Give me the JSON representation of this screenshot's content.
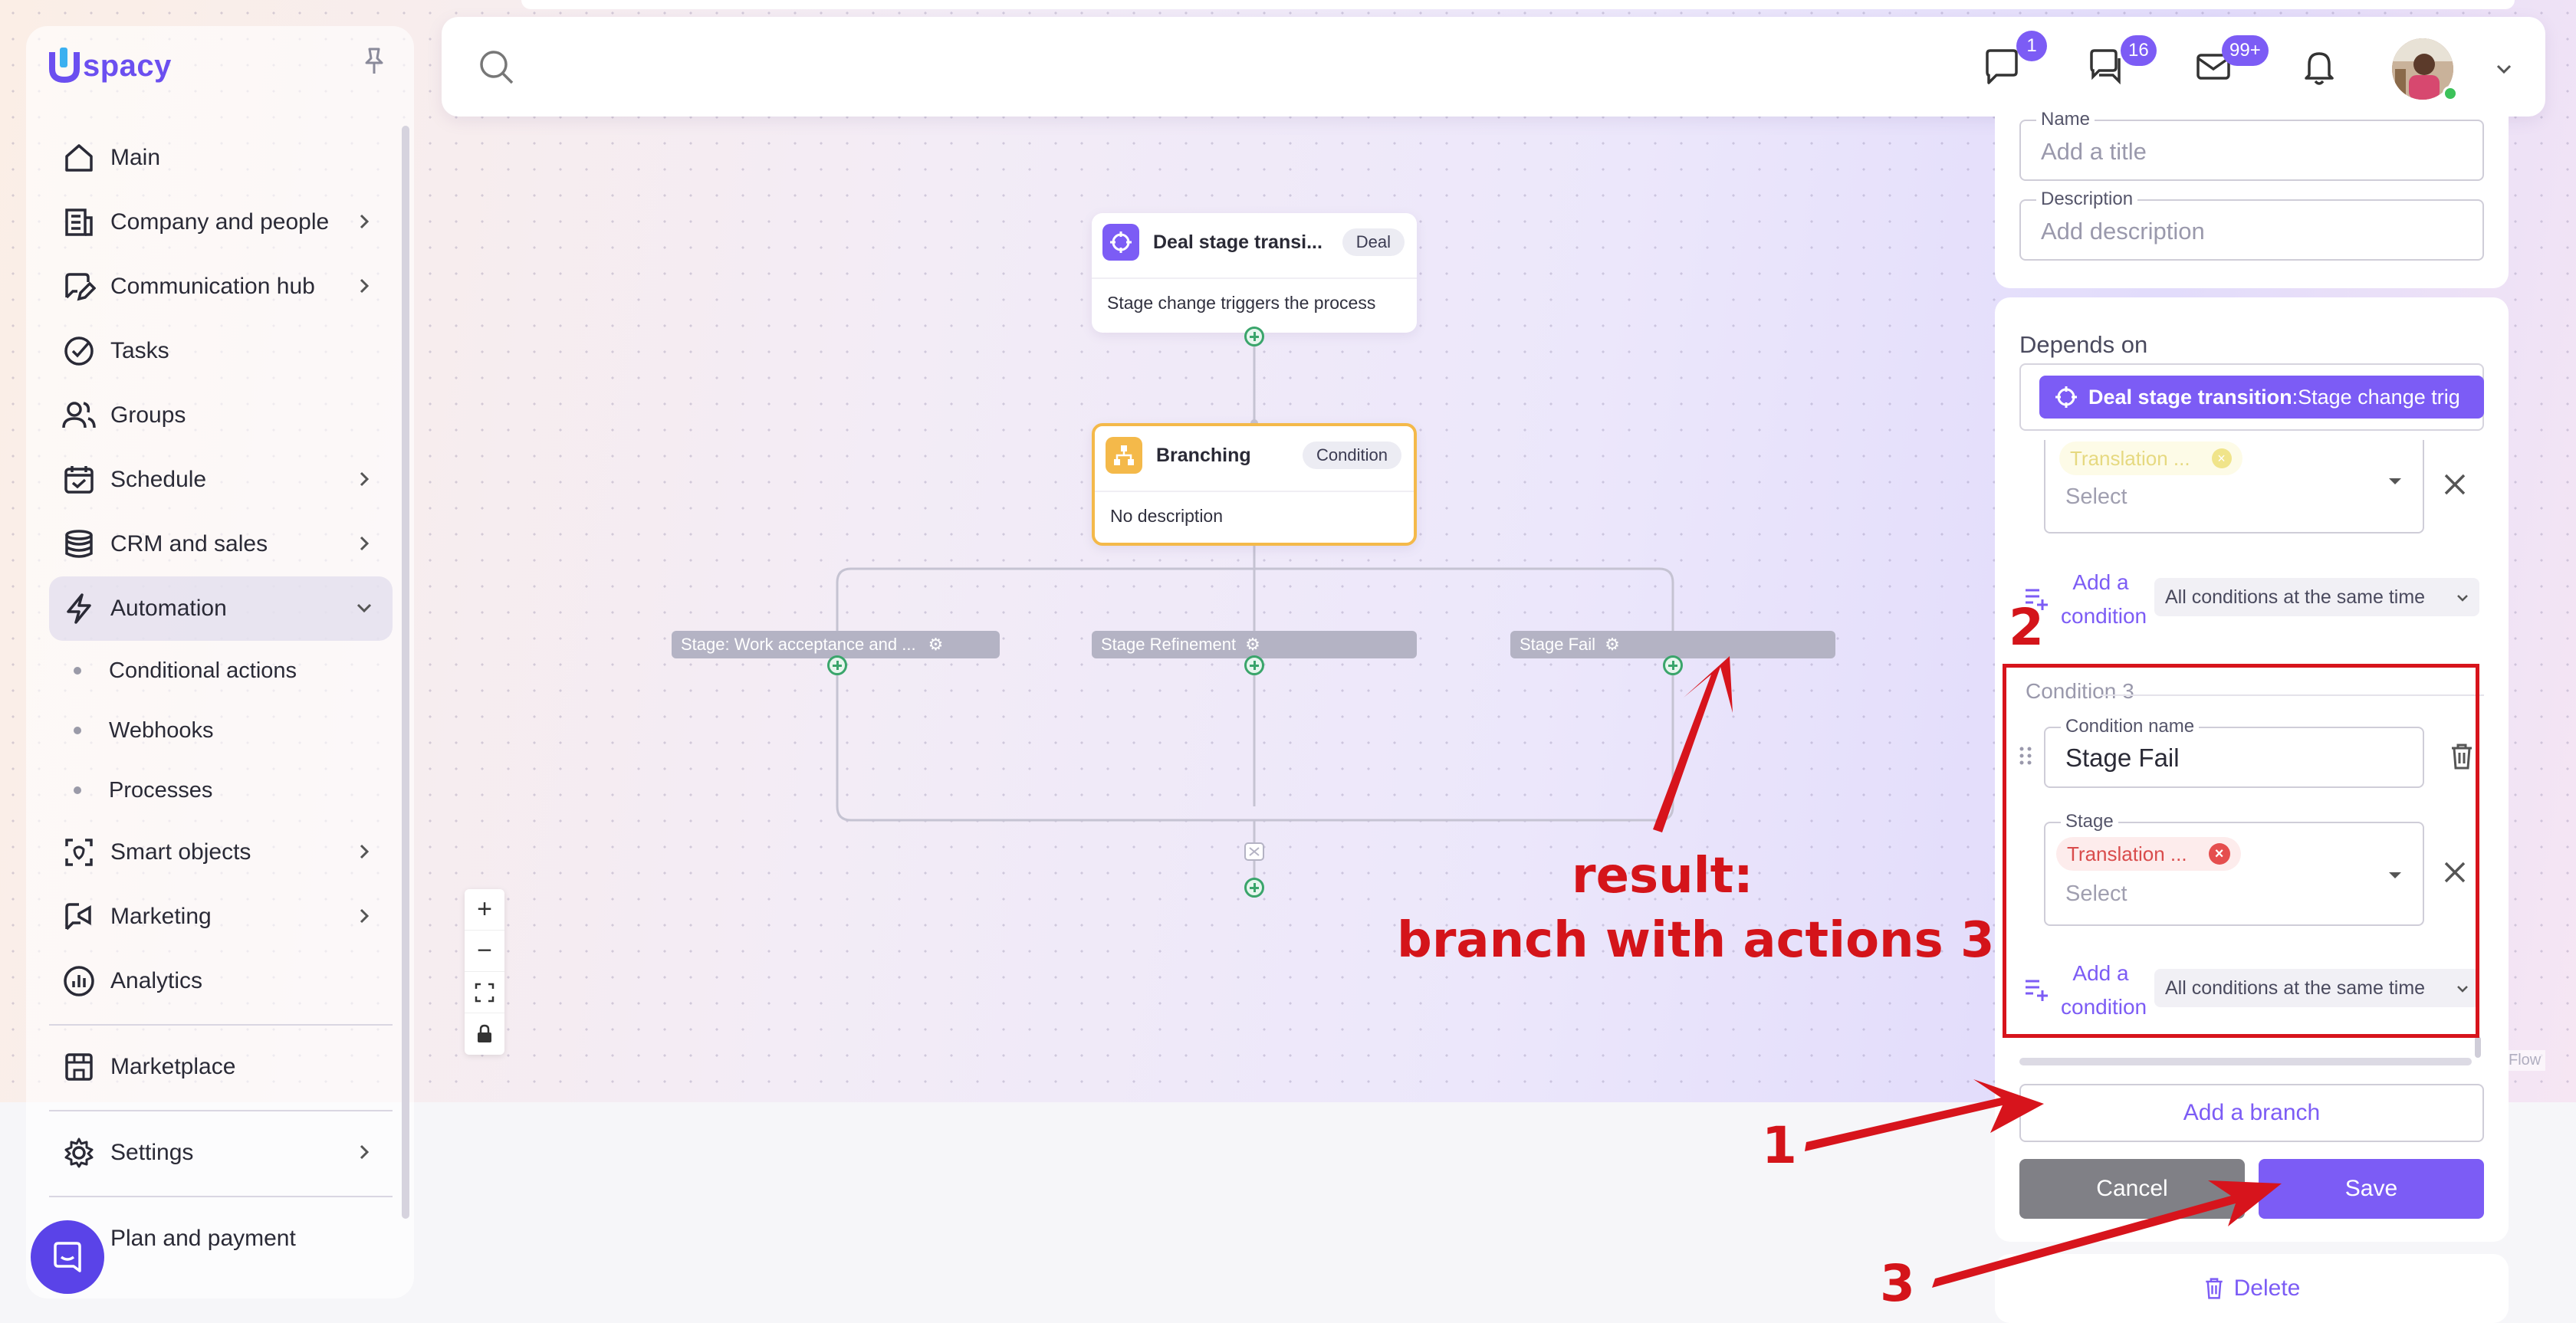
{
  "app": {
    "logo_text": "spacy"
  },
  "sidebar": {
    "items": [
      {
        "label": "Main",
        "icon": "home-icon"
      },
      {
        "label": "Company and people",
        "icon": "building-icon"
      },
      {
        "label": "Communication hub",
        "icon": "chat-edit-icon"
      },
      {
        "label": "Tasks",
        "icon": "check-circle-icon"
      },
      {
        "label": "Groups",
        "icon": "users-icon"
      },
      {
        "label": "Schedule",
        "icon": "calendar-icon"
      },
      {
        "label": "CRM and sales",
        "icon": "coins-icon"
      },
      {
        "label": "Automation",
        "icon": "bolt-icon"
      }
    ],
    "automation_sub": [
      "Conditional actions",
      "Webhooks",
      "Processes"
    ],
    "items2": [
      {
        "label": "Smart objects",
        "icon": "smart-object-icon"
      },
      {
        "label": "Marketing",
        "icon": "megaphone-icon"
      },
      {
        "label": "Analytics",
        "icon": "chart-circle-icon"
      }
    ],
    "marketplace": "Marketplace",
    "settings": "Settings",
    "plan": "Plan and payment"
  },
  "topbar": {
    "badges": {
      "chat": "1",
      "comments": "16",
      "mail": "99+"
    }
  },
  "canvas": {
    "trigger_node": {
      "title": "Deal stage transi...",
      "tag": "Deal",
      "body": "Stage change triggers the process"
    },
    "branch_node": {
      "title": "Branching",
      "tag": "Condition",
      "body": "No description"
    },
    "branches": [
      "Stage: Work acceptance and ...",
      "Stage Refinement",
      "Stage Fail"
    ],
    "flow_tag": "Flow"
  },
  "panel": {
    "name_label": "Name",
    "name_placeholder": "Add a title",
    "description_label": "Description",
    "description_placeholder": "Add description",
    "depends_on": "Depends on",
    "depends_chip_bold": "Deal stage transition",
    "depends_chip_rest": " :Stage change trig",
    "cond2": {
      "chip": "Translation ...",
      "select": "Select"
    },
    "add_condition": "Add a condition",
    "conditions_mode": "All conditions at the same time",
    "cond3": {
      "title": "Condition 3",
      "name_label": "Condition name",
      "name_value": "Stage Fail",
      "stage_label": "Stage",
      "chip": "Translation ...",
      "select": "Select"
    },
    "add_branch": "Add a branch",
    "cancel": "Cancel",
    "save": "Save",
    "delete": "Delete"
  },
  "annotations": {
    "result_line1": "result:",
    "result_line2": "branch with actions 3",
    "n1": "1",
    "n2": "2",
    "n3": "3"
  },
  "colors": {
    "accent": "#7c5cf5",
    "annotation": "#d7141c",
    "branch_node_border": "#f4b94a"
  }
}
